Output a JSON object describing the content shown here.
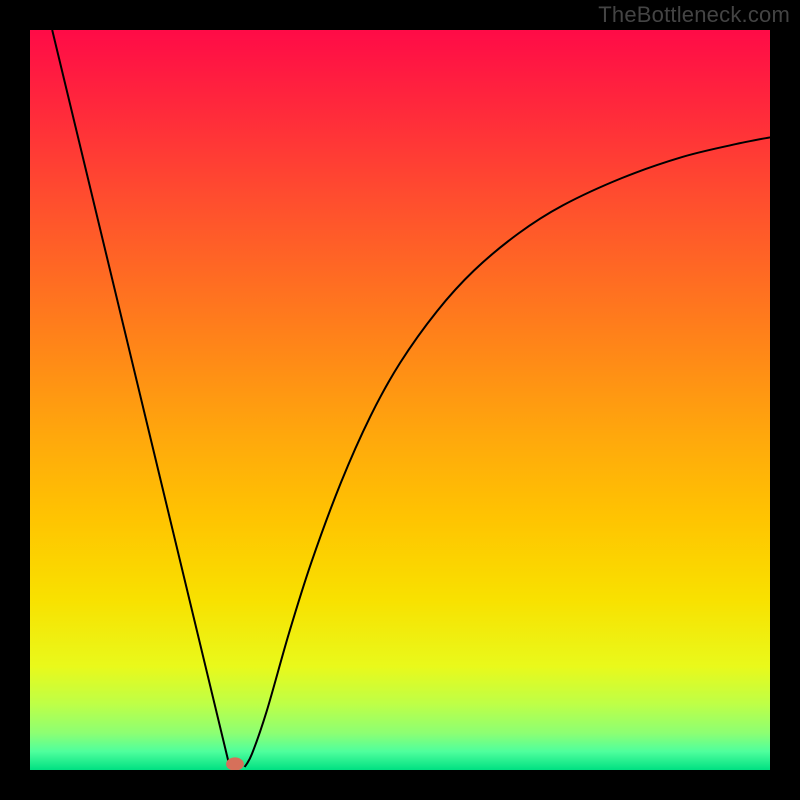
{
  "watermark": "TheBottleneck.com",
  "chart_data": {
    "type": "line",
    "title": "",
    "xlabel": "",
    "ylabel": "",
    "xlim": [
      0,
      100
    ],
    "ylim": [
      0,
      100
    ],
    "grid": false,
    "legend": false,
    "background_gradient": {
      "stops": [
        {
          "pos": 0.0,
          "color": "#ff0b47"
        },
        {
          "pos": 0.11,
          "color": "#ff2a3b"
        },
        {
          "pos": 0.22,
          "color": "#ff4b2f"
        },
        {
          "pos": 0.33,
          "color": "#ff6a23"
        },
        {
          "pos": 0.44,
          "color": "#ff8917"
        },
        {
          "pos": 0.55,
          "color": "#ffa80c"
        },
        {
          "pos": 0.66,
          "color": "#ffc401"
        },
        {
          "pos": 0.77,
          "color": "#f8e100"
        },
        {
          "pos": 0.86,
          "color": "#e9f91b"
        },
        {
          "pos": 0.91,
          "color": "#bfff46"
        },
        {
          "pos": 0.95,
          "color": "#8dff73"
        },
        {
          "pos": 0.975,
          "color": "#4fff9d"
        },
        {
          "pos": 1.0,
          "color": "#00e082"
        }
      ]
    },
    "series": [
      {
        "name": "left-branch",
        "type": "line",
        "color": "#000000",
        "width": 2,
        "points": [
          {
            "x": 3.0,
            "y": 100.0
          },
          {
            "x": 26.8,
            "y": 1.2
          }
        ]
      },
      {
        "name": "right-branch",
        "type": "line",
        "color": "#000000",
        "width": 2,
        "points": [
          {
            "x": 29.0,
            "y": 0.4
          },
          {
            "x": 30.0,
            "y": 2.2
          },
          {
            "x": 32.0,
            "y": 8.0
          },
          {
            "x": 35.0,
            "y": 18.5
          },
          {
            "x": 38.0,
            "y": 28.0
          },
          {
            "x": 42.0,
            "y": 38.8
          },
          {
            "x": 46.0,
            "y": 47.8
          },
          {
            "x": 50.0,
            "y": 55.0
          },
          {
            "x": 55.0,
            "y": 62.0
          },
          {
            "x": 60.0,
            "y": 67.5
          },
          {
            "x": 66.0,
            "y": 72.5
          },
          {
            "x": 72.0,
            "y": 76.3
          },
          {
            "x": 80.0,
            "y": 80.0
          },
          {
            "x": 88.0,
            "y": 82.8
          },
          {
            "x": 95.0,
            "y": 84.5
          },
          {
            "x": 100.0,
            "y": 85.5
          }
        ]
      }
    ],
    "marker": {
      "x": 27.7,
      "y": 0.8,
      "rx": 1.2,
      "ry": 0.9,
      "color": "#d6705a"
    }
  }
}
